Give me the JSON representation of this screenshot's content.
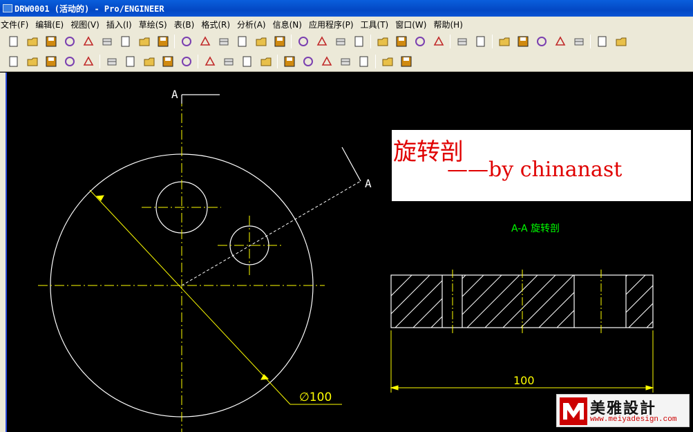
{
  "window": {
    "title": "DRW0001 (活动的) - Pro/ENGINEER"
  },
  "menubar": {
    "items": [
      {
        "label": "文件(F)"
      },
      {
        "label": "编辑(E)"
      },
      {
        "label": "视图(V)"
      },
      {
        "label": "插入(I)"
      },
      {
        "label": "草绘(S)"
      },
      {
        "label": "表(B)"
      },
      {
        "label": "格式(R)"
      },
      {
        "label": "分析(A)"
      },
      {
        "label": "信息(N)"
      },
      {
        "label": "应用程序(P)"
      },
      {
        "label": "工具(T)"
      },
      {
        "label": "窗口(W)"
      },
      {
        "label": "帮助(H)"
      }
    ]
  },
  "toolbar_row1": {
    "icons": [
      "new-file",
      "open-folder",
      "save",
      "save-copy",
      "print",
      "lock",
      "erase-not-displayed",
      "delete-old",
      "repaint",
      "spin",
      "zoom-spin",
      "zoom-in",
      "zoom-out",
      "refit",
      "layers",
      "wireframe",
      "hidden-line",
      "no-hidden",
      "shading",
      "datum-plane",
      "datum-axis",
      "datum-point",
      "coordinate-system",
      "undo",
      "redo",
      "cut",
      "copy",
      "paste",
      "paste-special",
      "regenerate",
      "find",
      "select-box"
    ]
  },
  "toolbar_row2": {
    "icons": [
      "delete",
      "scale",
      "rotate",
      "move",
      "copy-to",
      "table",
      "show-dimensions",
      "ordinate",
      "ref-dimension",
      "split",
      "slash",
      "symbol",
      "note",
      "balloon",
      "surface-finish",
      "geometric-tolerance",
      "table-grid",
      "regenerate-table",
      "hatching",
      "view-properties",
      "whats-this"
    ]
  },
  "drawing": {
    "section_label_top": "A",
    "section_label_right": "A",
    "view_title": "A-A  旋转剖",
    "diameter_dim": "∅100",
    "length_dim": "100",
    "line_color": "#ffffff",
    "centerline_color": "#ffff00",
    "dim_color": "#ffff00",
    "note_color": "#00ff00"
  },
  "annotation": {
    "title": "旋转剖",
    "byline": "——by chinanast",
    "color": "#e00000"
  },
  "watermark": {
    "brand": "美雅設計",
    "url": "www.meiyadesign.com"
  }
}
